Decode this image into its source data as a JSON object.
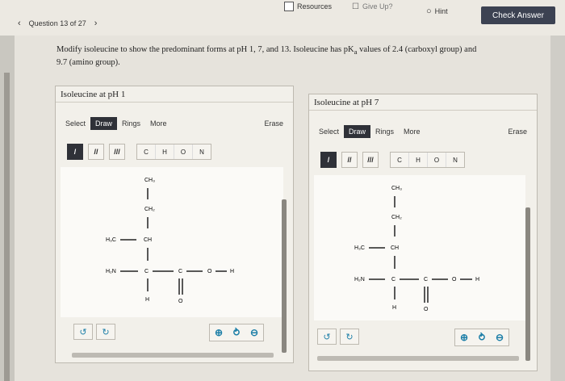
{
  "header": {
    "resources": "Resources",
    "give_up": "Give Up?",
    "hint": "Hint",
    "check_answer": "Check Answer"
  },
  "question_nav": {
    "label": "Question 13 of 27"
  },
  "prompt": {
    "line1": "Modify isoleucine to show the predominant forms at pH 1, 7, and 13. Isoleucine has pK",
    "sub": "a",
    "line1b": " values of 2.4 (carboxyl group) and",
    "line2": "9.7 (amino group)."
  },
  "panels": [
    {
      "title": "Isoleucine at pH 1"
    },
    {
      "title": "Isoleucine at pH 7"
    }
  ],
  "toolbar": {
    "select": "Select",
    "draw": "Draw",
    "rings": "Rings",
    "more": "More",
    "erase": "Erase"
  },
  "bonds": {
    "single": "/",
    "double": "//",
    "triple": "///"
  },
  "atoms": [
    "C",
    "H",
    "O",
    "N"
  ],
  "molecule": {
    "ch3_top": "CH₃",
    "ch2": "CH₂",
    "h3c": "H₃C",
    "ch": "CH",
    "h2n": "H₂N",
    "c_alpha": "C",
    "c_carbonyl": "C",
    "o_single": "O",
    "h_acid": "H",
    "h_alpha": "H",
    "o_double": "O"
  }
}
